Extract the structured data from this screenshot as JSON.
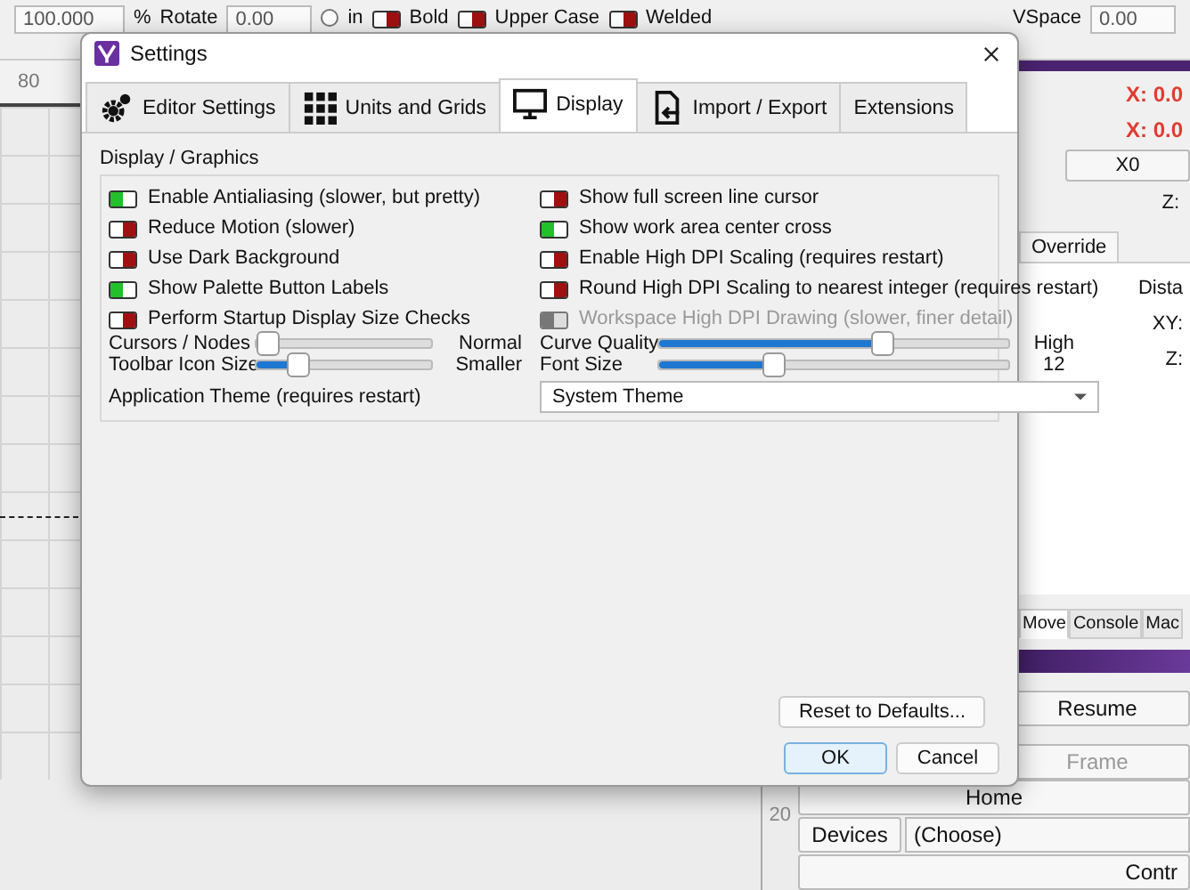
{
  "toolbar": {
    "scale_value": "100.000",
    "scale_unit": "%",
    "rotate_label": "Rotate",
    "rotate_value": "0.00",
    "unit_radio": {
      "label": "in",
      "selected": false
    },
    "styles": [
      {
        "label": "Bold",
        "on": false
      },
      {
        "label": "Upper Case",
        "on": false
      },
      {
        "label": "Welded",
        "on": false
      }
    ],
    "vspace_label": "VSpace",
    "vspace_value": "0.00"
  },
  "ruler": {
    "top_label": "80",
    "side_label": "20"
  },
  "right_panel": {
    "coords": [
      "X: 0.0",
      "X: 0.0"
    ],
    "x0_button": "X0",
    "z_label": "Z:",
    "tab": "Override",
    "distance_label": "Dista",
    "xy_label": "XY:",
    "z2_label": "Z:",
    "bottom_tabs": [
      {
        "label": "Move",
        "selected": true
      },
      {
        "label": "Console",
        "selected": false
      },
      {
        "label": "Mac",
        "selected": false
      }
    ],
    "resume_button": "Resume",
    "frame_button": {
      "label": "Frame",
      "disabled": true
    }
  },
  "controls": {
    "home_button": "Home",
    "devices_button": "Devices",
    "device_choice": "(Choose)",
    "control_button": "Contr"
  },
  "dialog": {
    "title": "Settings",
    "tabs": [
      {
        "label": "Editor Settings",
        "kind": "gear",
        "selected": false
      },
      {
        "label": "Units and Grids",
        "kind": "grid",
        "selected": false
      },
      {
        "label": "Display",
        "kind": "monitor",
        "selected": true
      },
      {
        "label": "Import / Export",
        "kind": "import",
        "selected": false
      },
      {
        "label": "Extensions",
        "kind": "plain",
        "selected": false
      }
    ],
    "group_title": "Display / Graphics",
    "left_toggles": [
      {
        "label": "Enable Antialiasing (slower, but pretty)",
        "on": true,
        "disabled": false
      },
      {
        "label": "Reduce Motion (slower)",
        "on": false,
        "disabled": false
      },
      {
        "label": "Use Dark Background",
        "on": false,
        "disabled": false
      },
      {
        "label": "Show Palette Button Labels",
        "on": true,
        "disabled": false
      },
      {
        "label": "Perform Startup Display Size Checks",
        "on": false,
        "disabled": false
      }
    ],
    "right_toggles": [
      {
        "label": "Show full screen line cursor",
        "on": false,
        "disabled": false
      },
      {
        "label": "Show work area center cross",
        "on": true,
        "disabled": false
      },
      {
        "label": "Enable High DPI Scaling (requires restart)",
        "on": false,
        "disabled": false
      },
      {
        "label": "Round High DPI Scaling to nearest integer (requires restart)",
        "on": false,
        "disabled": false
      },
      {
        "label": "Workspace High DPI Drawing (slower, finer detail)",
        "on": false,
        "disabled": true
      }
    ],
    "left_sliders": [
      {
        "label": "Cursors / Nodes",
        "level": 0.0,
        "reading": "Normal"
      },
      {
        "label": "Toolbar Icon Size",
        "level": 0.2,
        "reading": "Smaller"
      }
    ],
    "right_sliders": [
      {
        "label": "Curve Quality",
        "level": 0.65,
        "reading": "High"
      },
      {
        "label": "Font Size",
        "level": 0.32,
        "reading": "12"
      }
    ],
    "theme_label": "Application Theme (requires restart)",
    "theme_value": "System Theme",
    "reset_button": "Reset to Defaults...",
    "ok_button": "OK",
    "cancel_button": "Cancel"
  }
}
